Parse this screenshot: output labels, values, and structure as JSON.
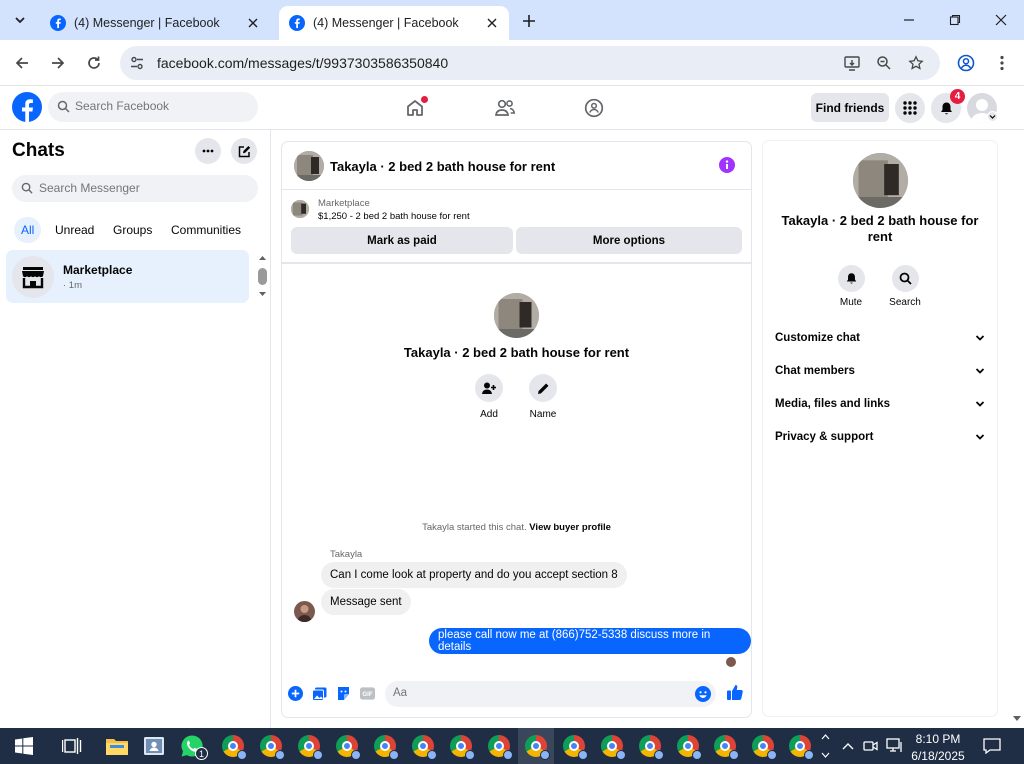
{
  "browser": {
    "tabs": [
      {
        "title": "(4) Messenger | Facebook",
        "active": false
      },
      {
        "title": "(4) Messenger | Facebook",
        "active": true
      }
    ],
    "url": "facebook.com/messages/t/9937303586350840"
  },
  "fb_header": {
    "search_placeholder": "Search Facebook",
    "find_friends": "Find friends",
    "notification_count": "4"
  },
  "sidebar": {
    "title": "Chats",
    "search_placeholder": "Search Messenger",
    "filters": [
      "All",
      "Unread",
      "Groups",
      "Communities"
    ],
    "active_filter": "All",
    "chats": [
      {
        "name": "Marketplace",
        "time": "· 1m"
      }
    ]
  },
  "conversation": {
    "title": "Takayla · 2 bed 2 bath house for rent",
    "marketplace_label": "Marketplace",
    "listing": "$1,250 - 2 bed 2 bath house for rent",
    "mark_paid": "Mark as paid",
    "more_options": "More options",
    "center_title": "Takayla · 2 bed 2 bath house for rent",
    "actions": {
      "add": "Add",
      "name": "Name"
    },
    "started_text": "Takayla started this chat.",
    "view_profile": "View buyer profile",
    "sender": "Takayla",
    "messages": [
      {
        "from": "Takayla",
        "text": "Can I come look at property and do you accept section 8"
      },
      {
        "from": "Takayla",
        "text": "Message sent"
      },
      {
        "from": "me",
        "text": "please call now me at (866)752-5338 discuss more in details"
      }
    ],
    "composer_placeholder": "Aa"
  },
  "info_panel": {
    "title": "Takayla · 2 bed 2 bath house for rent",
    "actions": {
      "mute": "Mute",
      "search": "Search"
    },
    "sections": [
      "Customize chat",
      "Chat members",
      "Media, files and links",
      "Privacy & support"
    ]
  },
  "taskbar": {
    "whatsapp_badge": "1",
    "time": "8:10 PM",
    "date": "6/18/2025"
  },
  "colors": {
    "accent": "#0866ff",
    "tabbar": "#d3e3fd",
    "taskbar": "#1f2e45",
    "badge": "#e41e3f",
    "info_icon": "#a033ff"
  }
}
